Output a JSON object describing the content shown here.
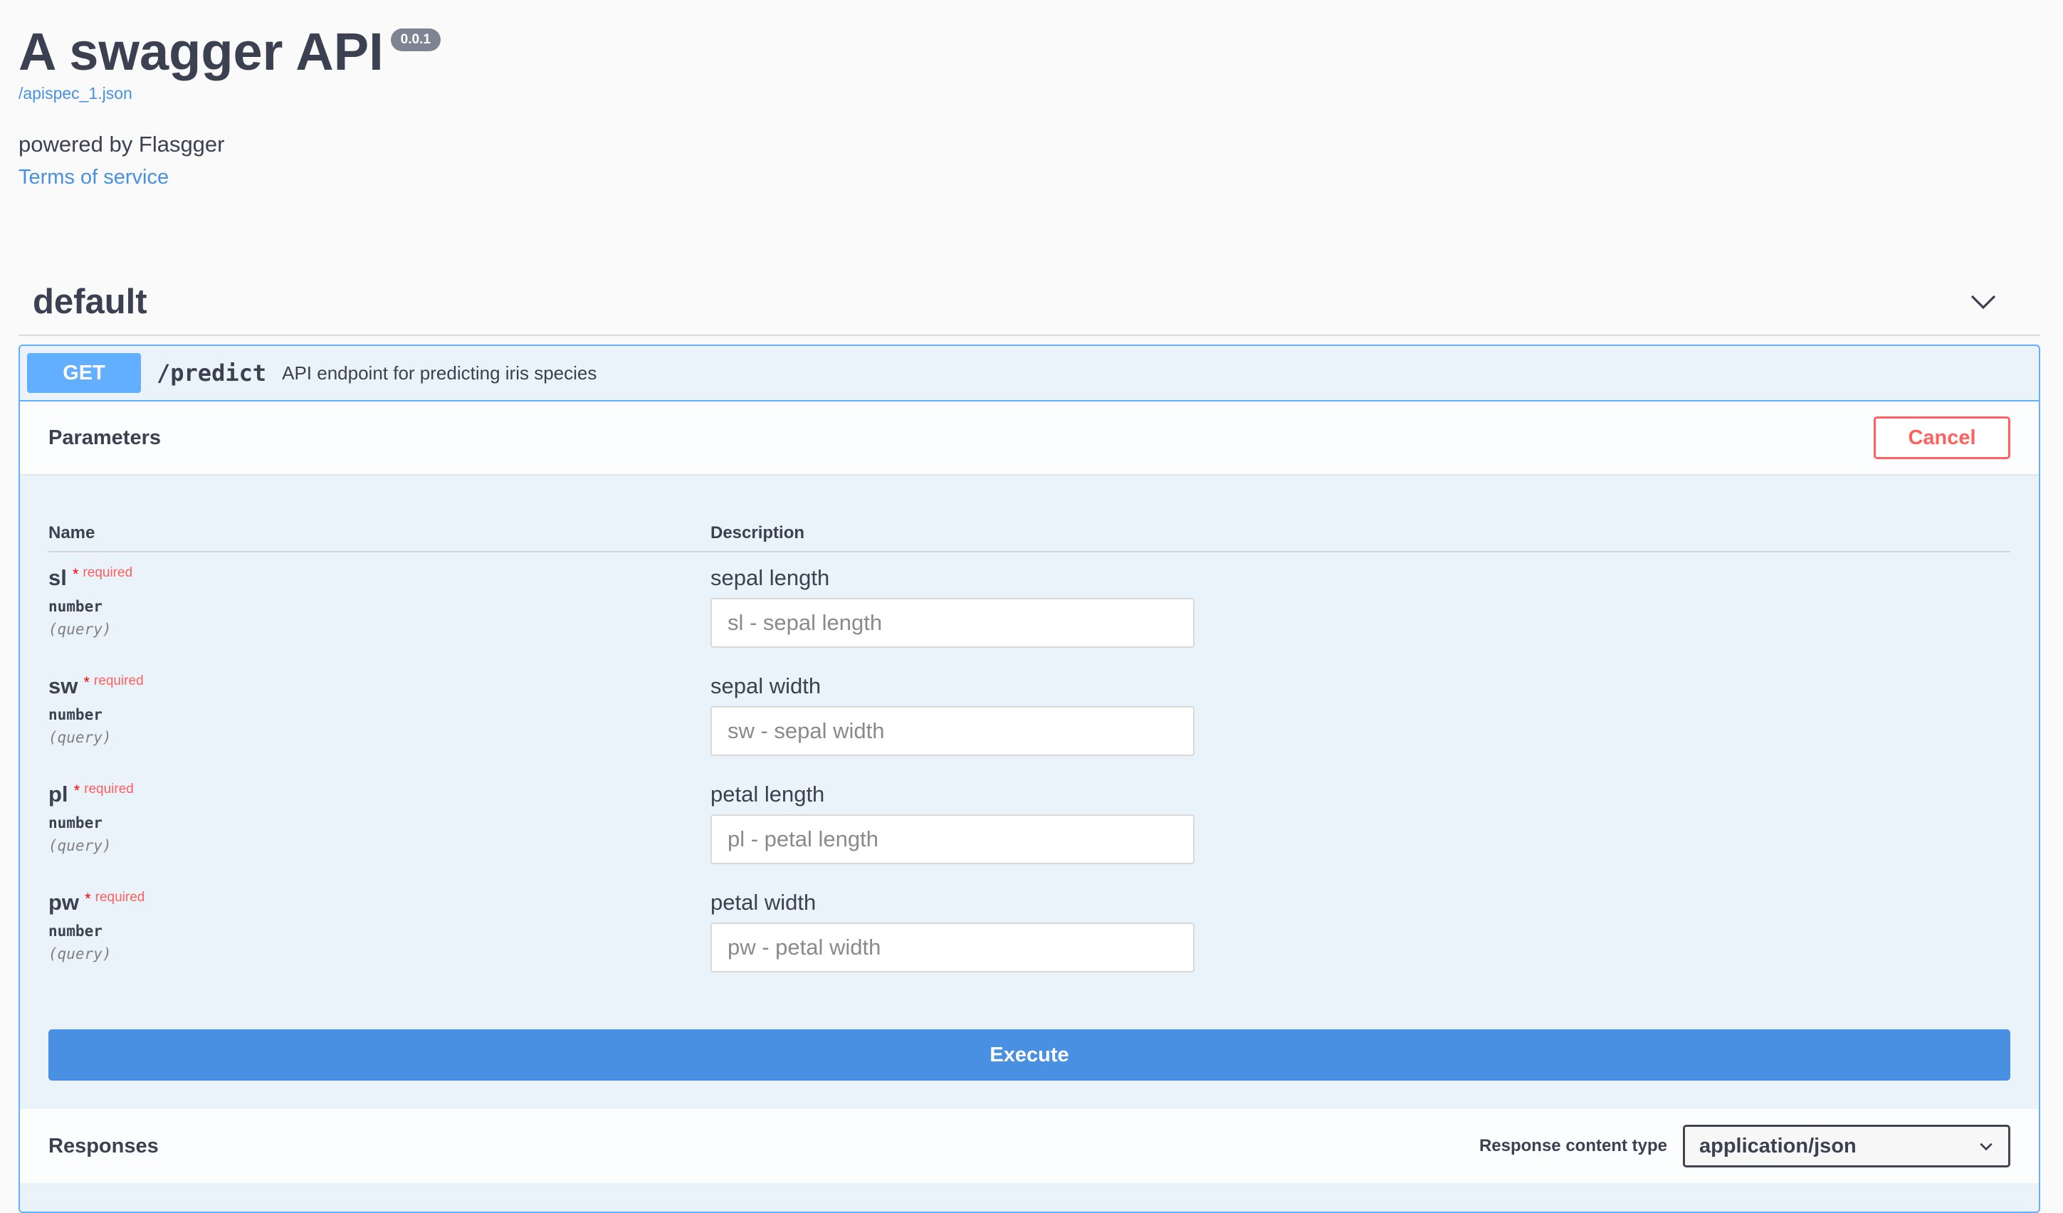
{
  "info": {
    "title": "A swagger API",
    "version": "0.0.1",
    "spec_link": "/apispec_1.json",
    "description": "powered by Flasgger",
    "terms_link": "Terms of service"
  },
  "tag": {
    "name": "default",
    "chevron_icon": "chevron-down-icon"
  },
  "operation": {
    "method": "GET",
    "path": "/predict",
    "summary": "API endpoint for predicting iris species",
    "parameters_title": "Parameters",
    "cancel_label": "Cancel",
    "columns": {
      "name": "Name",
      "description": "Description"
    },
    "required_label": "required",
    "required_star": "*",
    "params": [
      {
        "name": "sl",
        "type": "number",
        "in": "(query)",
        "description": "sepal length",
        "placeholder": "sl - sepal length"
      },
      {
        "name": "sw",
        "type": "number",
        "in": "(query)",
        "description": "sepal width",
        "placeholder": "sw - sepal width"
      },
      {
        "name": "pl",
        "type": "number",
        "in": "(query)",
        "description": "petal length",
        "placeholder": "pl - petal length"
      },
      {
        "name": "pw",
        "type": "number",
        "in": "(query)",
        "description": "petal width",
        "placeholder": "pw - petal width"
      }
    ],
    "execute_label": "Execute",
    "responses_title": "Responses",
    "response_content_type_label": "Response content type",
    "response_content_type_value": "application/json"
  },
  "colors": {
    "get": "#61affe",
    "execute": "#4990e2",
    "cancel": "#ff6060",
    "link": "#4990e2"
  }
}
